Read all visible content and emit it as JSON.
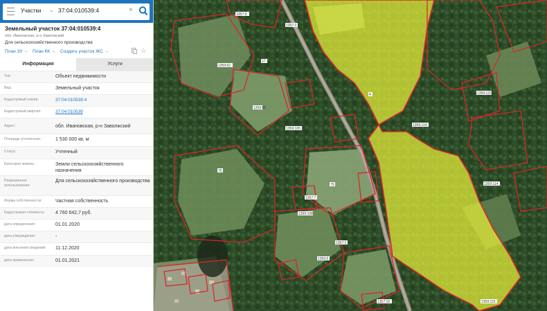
{
  "search": {
    "layer": "Участки",
    "value": "37:04:010539:4"
  },
  "object": {
    "title": "Земельный участок 37:04:010539:4",
    "subtitle": "обл. Ивановская, р-н Заволжский",
    "purpose": "Для сельскохозяйственного производства",
    "links": [
      "План ЗУ →",
      "План КК →",
      "Создать участок ЖС →"
    ]
  },
  "tabs": {
    "info": "Информация",
    "services": "Услуги"
  },
  "info": [
    {
      "label": "Тип:",
      "value": "Объект недвижимости"
    },
    {
      "label": "Вид:",
      "value": "Земельный участок"
    },
    {
      "label": "Кадастровый номер:",
      "value": "37:04:010539:4"
    },
    {
      "label": "Кадастровый квартал:",
      "value": "37:04:010539"
    },
    {
      "label": "Адрес:",
      "value": "обл. Ивановская, р-н Заволжский"
    },
    {
      "label": "Площадь уточненная:",
      "value": "1 530 000 кв. м"
    },
    {
      "label": "Статус:",
      "value": "Учтенный"
    },
    {
      "label": "Категория земель:",
      "value": "Земли сельскохозяйственного назначения"
    },
    {
      "label": "Разрешенное использование:",
      "value": "Для сельскохозяйственного производства"
    },
    {
      "label": "Форма собственности:",
      "value": "Частная собственность"
    },
    {
      "label": "Кадастровая стоимость:",
      "value": "4 760 642,7 руб."
    },
    {
      "label": "дата определения:",
      "value": "01.01.2020"
    },
    {
      "label": "дата утверждения:",
      "value": "-"
    },
    {
      "label": "дата внесения сведений:",
      "value": "11.12.2020"
    },
    {
      "label": "дата применения:",
      "value": "01.01.2021"
    }
  ],
  "map_labels": [
    "1357:9",
    "1357:3",
    "1359:62",
    "27",
    "1359:62",
    "1359:105",
    "76",
    "79",
    "1357:7",
    "1359:114",
    "4",
    "1359:108",
    "1357:2",
    "1359:5",
    "1357:10",
    "1359:122",
    "1359:114",
    "1359:115"
  ],
  "colors": {
    "header": "#1d74be",
    "selected_parcel": "#e8f03a",
    "parcel_border": "#d8262a"
  }
}
